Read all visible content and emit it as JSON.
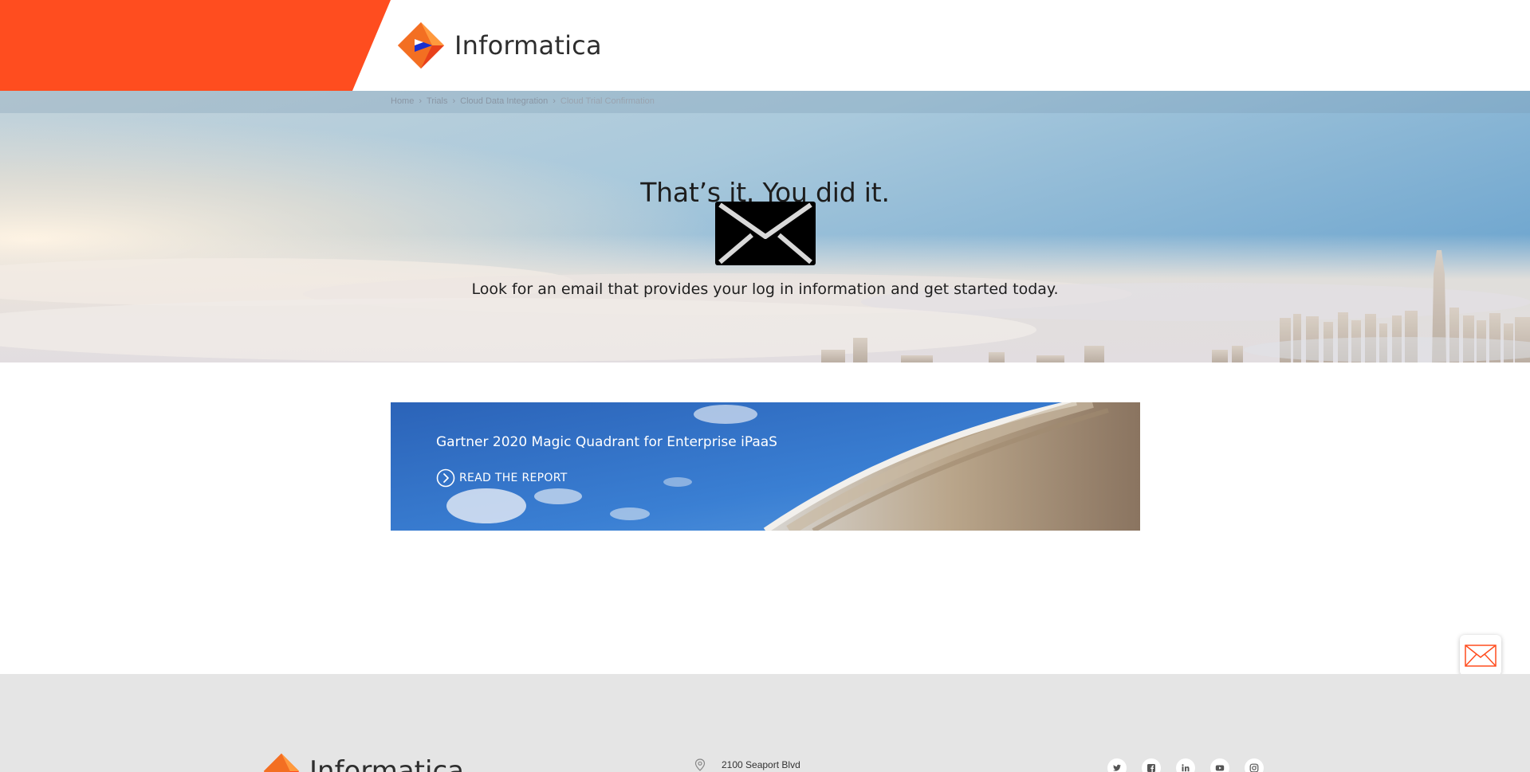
{
  "header": {
    "brand_name": "Informatica",
    "accent_color": "#ff4d1f"
  },
  "breadcrumb": {
    "items": [
      "Home",
      "Trials",
      "Cloud Data Integration",
      "Cloud Trial Confirmation"
    ],
    "separator_icon": "chevron-right-icon"
  },
  "hero": {
    "title": "That’s it. You did it.",
    "icon": "envelope-icon",
    "subtitle": "Look for an email that provides your log in information and get started today."
  },
  "promo": {
    "title": "Gartner 2020 Magic Quadrant for Enterprise iPaaS",
    "cta_label": "READ THE REPORT",
    "cta_icon": "circle-arrow-right-icon"
  },
  "floating_contact": {
    "icon": "mail-icon",
    "icon_color": "#ff4d1f"
  },
  "footer": {
    "brand_name": "Informatica",
    "address_icon": "location-pin-icon",
    "address": "2100 Seaport Blvd",
    "social_icons": [
      "twitter-icon",
      "facebook-icon",
      "linkedin-icon",
      "youtube-icon",
      "instagram-icon"
    ]
  }
}
